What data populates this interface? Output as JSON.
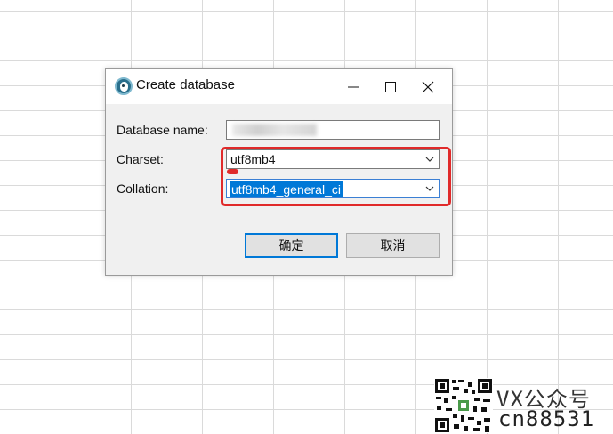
{
  "dialog": {
    "title": "Create database",
    "fields": {
      "name_label": "Database name:",
      "charset_label": "Charset:",
      "charset_value": "utf8mb4",
      "collation_label": "Collation:",
      "collation_value": "utf8mb4_general_ci"
    },
    "buttons": {
      "ok_label": "确定",
      "cancel_label": "取消"
    }
  },
  "watermark": {
    "line1": "VX公众号",
    "line2": "cn88531"
  },
  "colors": {
    "highlight": "#e02a2a",
    "selection": "#0078d7"
  }
}
